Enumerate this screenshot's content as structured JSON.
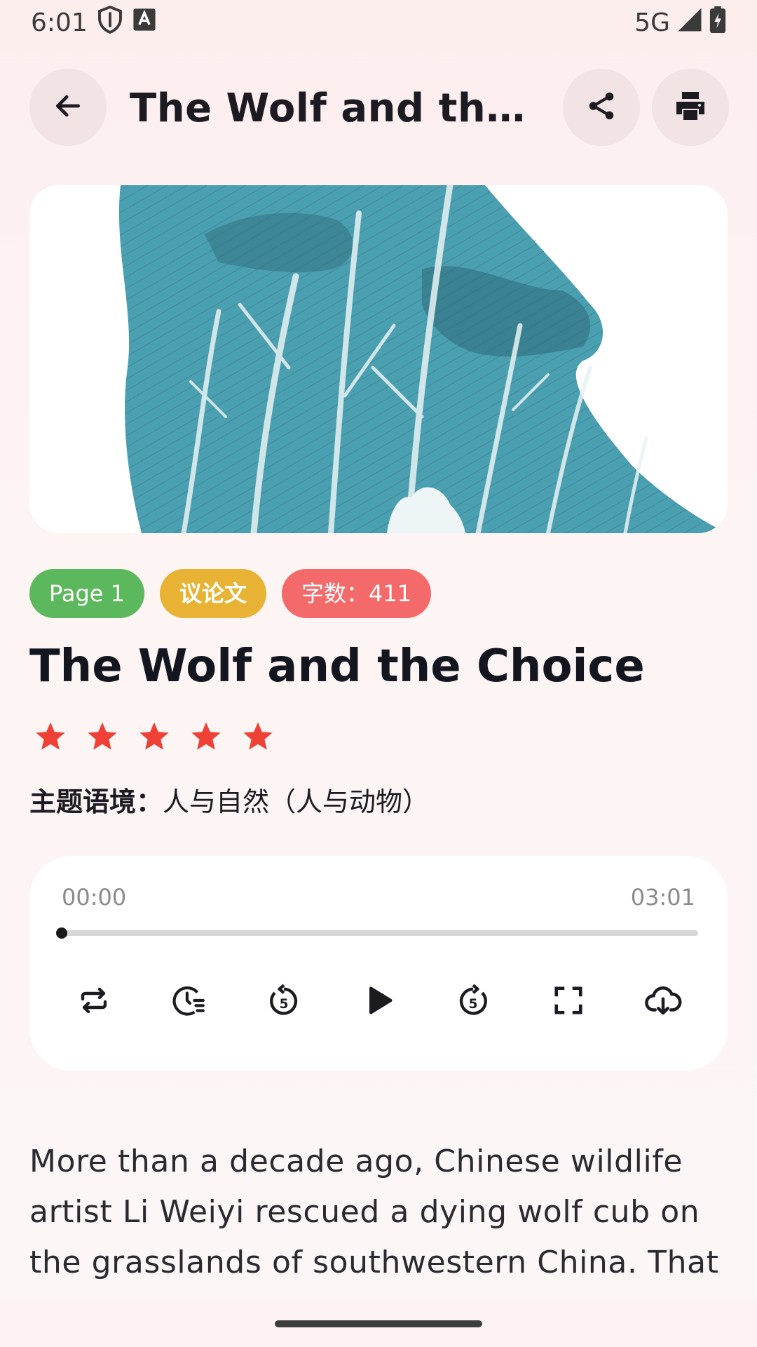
{
  "status": {
    "time": "6:01",
    "network": "5G"
  },
  "header": {
    "title": "The Wolf and the C⋯",
    "back_icon": "arrow-left-icon",
    "share_icon": "share-icon",
    "print_icon": "print-icon"
  },
  "tags": {
    "page": "Page 1",
    "genre": "议论文",
    "words": "字数：411"
  },
  "article": {
    "title": "The Wolf and the Choice",
    "rating": 5,
    "rating_max": 5,
    "theme_label": "主题语境：",
    "theme_value": "人与自然（人与动物）",
    "body": "More than a decade ago, Chinese wildlife artist Li Weiyi rescued a dying wolf cub on the grasslands of southwestern China. That decision led to an extraordinary bond and"
  },
  "player": {
    "current_time": "00:00",
    "duration": "03:01",
    "progress": 0,
    "controls": [
      "repeat-icon",
      "sleep-timer-icon",
      "replay-5-icon",
      "play-icon",
      "forward-5-icon",
      "fullscreen-icon",
      "download-icon"
    ]
  },
  "colors": {
    "tag_page": "#5cb85c",
    "tag_genre": "#e8b334",
    "tag_words": "#f46a6a",
    "star": "#ee4035",
    "hero_teal": "#4a9fb0"
  }
}
